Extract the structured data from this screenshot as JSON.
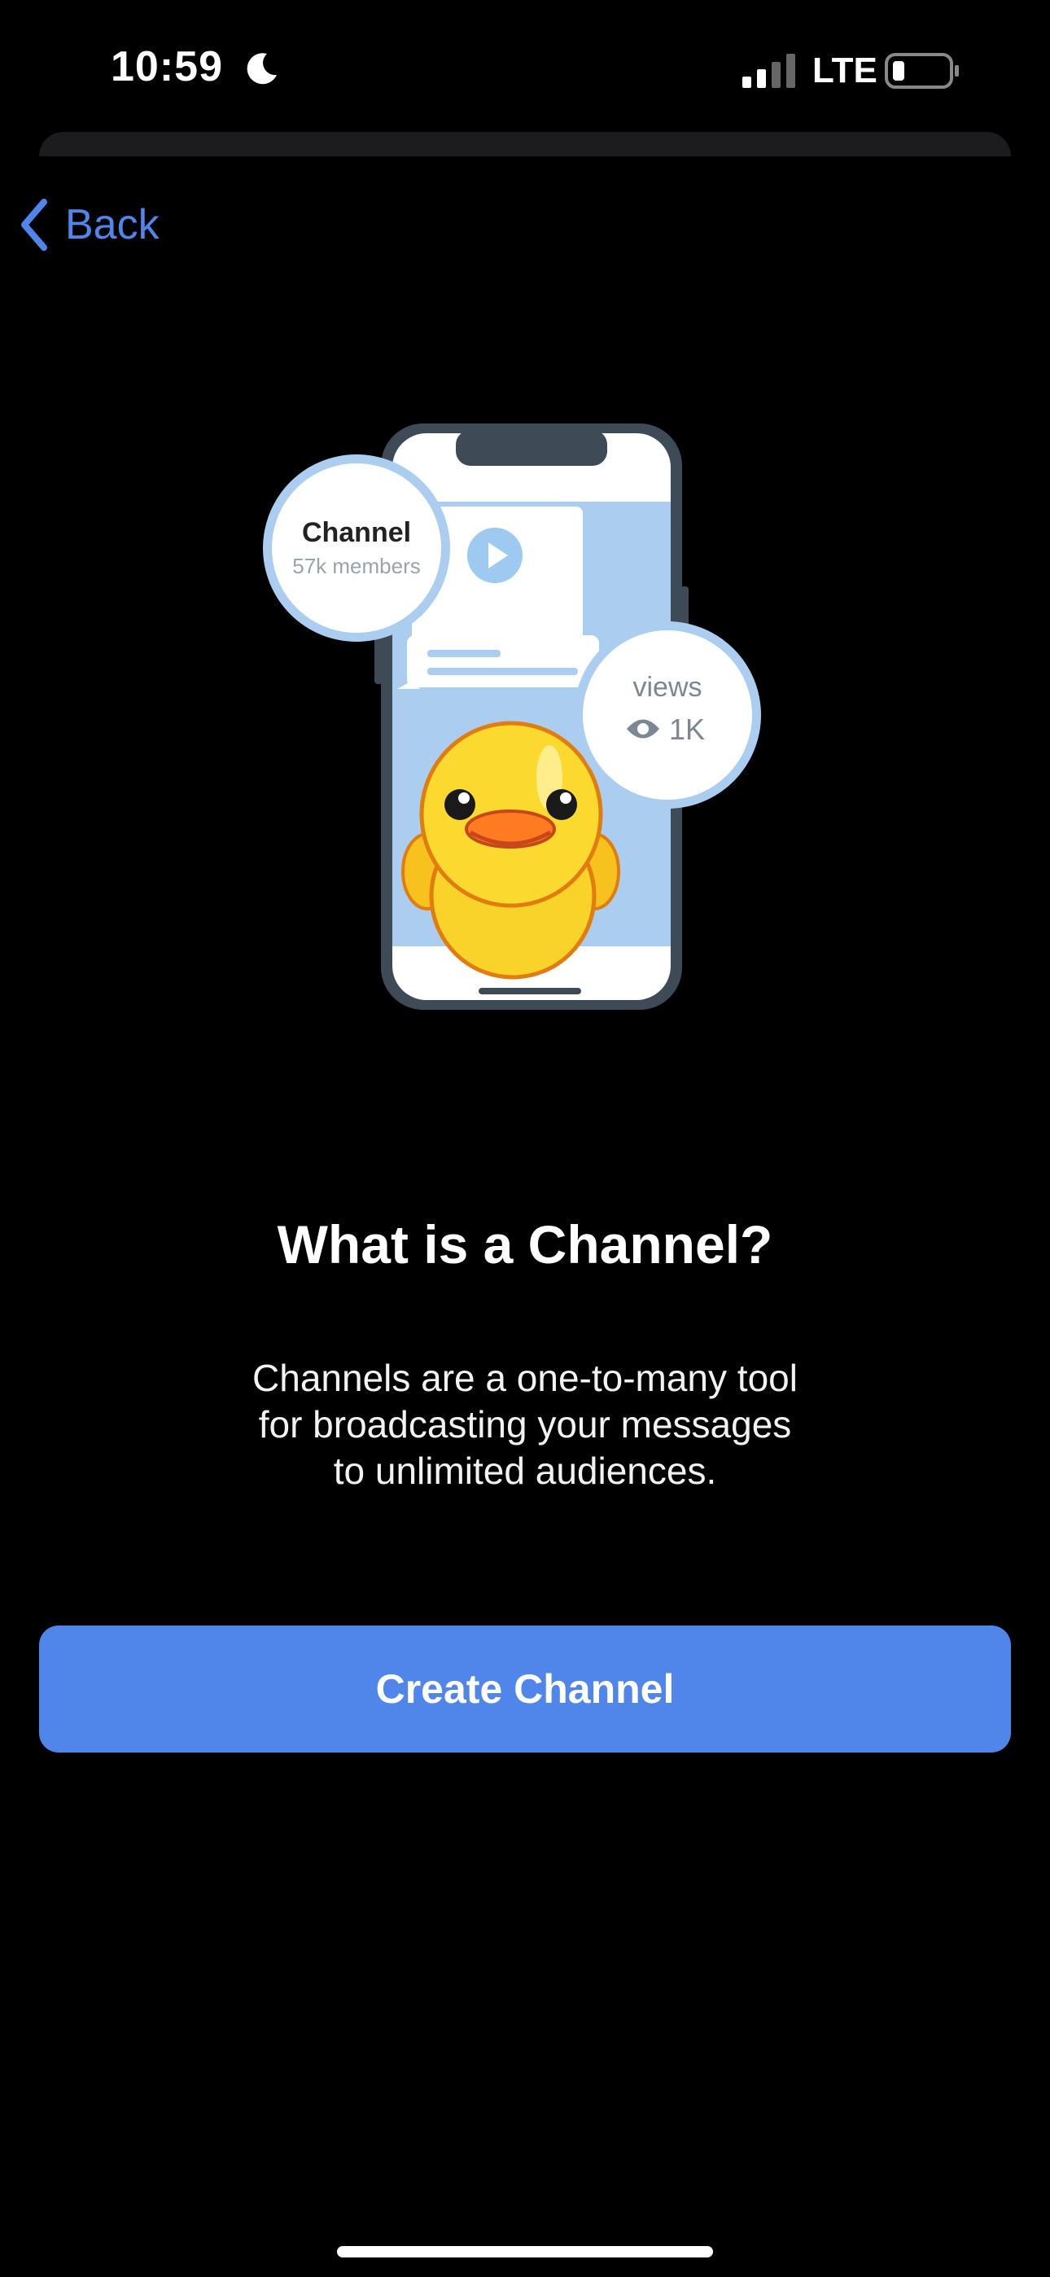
{
  "status_bar": {
    "time": "10:59",
    "network": "LTE",
    "icons": [
      "moon-icon",
      "signal-icon",
      "battery-icon"
    ]
  },
  "nav": {
    "back_label": "Back"
  },
  "illustration": {
    "card_title": "Channel",
    "card_subtitle": "57k members",
    "views_label": "views",
    "views_count": "1K"
  },
  "content": {
    "title": "What is a Channel?",
    "description_lines": [
      "Channels are a one-to-many tool",
      "for broadcasting your messages",
      "to unlimited audiences."
    ]
  },
  "actions": {
    "create_label": "Create Channel"
  },
  "colors": {
    "accent": "#5085ea",
    "link": "#4f86ec",
    "background": "#000000"
  }
}
